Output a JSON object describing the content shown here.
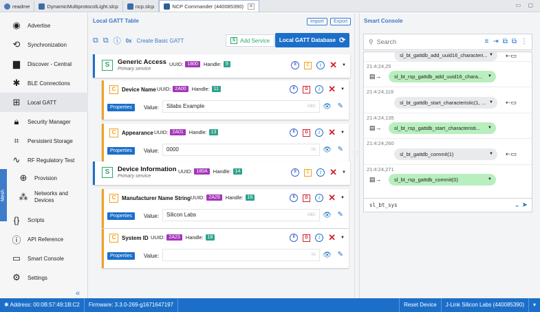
{
  "tabs": [
    {
      "label": "readme",
      "icon": "globe-icon"
    },
    {
      "label": "DynamicMultiprotocolLight.slcp",
      "icon": "project-icon"
    },
    {
      "label": "ncp.slcp",
      "icon": "project-icon"
    },
    {
      "label": "NCP Commander (440085390)",
      "icon": "ncp-icon"
    }
  ],
  "sidebar": {
    "items": [
      {
        "label": "Advertise",
        "icon": "broadcast-icon"
      },
      {
        "label": "Synchronization",
        "icon": "sync-icon"
      },
      {
        "label": "Discover - Central",
        "icon": "router-icon"
      },
      {
        "label": "BLE Connections",
        "icon": "bluetooth-icon"
      },
      {
        "label": "Local GATT",
        "icon": "table-icon"
      },
      {
        "label": "Security Manager",
        "icon": "lock-icon"
      },
      {
        "label": "Persistent Storage",
        "icon": "chip-icon"
      },
      {
        "label": "RF Regulatory Test",
        "icon": "wave-icon"
      },
      {
        "label": "Provision",
        "icon": "globe-icon"
      },
      {
        "label": "Networks and Devices",
        "icon": "network-icon"
      },
      {
        "label": "Scripts",
        "icon": "braces-icon"
      },
      {
        "label": "API Reference",
        "icon": "info-icon"
      },
      {
        "label": "Smart Console",
        "icon": "terminal-icon"
      },
      {
        "label": "Settings",
        "icon": "gear-icon"
      }
    ],
    "mesh_label": "Mesh",
    "collapse": "«"
  },
  "main": {
    "title": "Local GATT Table",
    "import": "Import",
    "export": "Export",
    "create_basic": "Create Basic GATT",
    "add_service": "Add Service",
    "local_db": "Local GATT Database",
    "services": [
      {
        "name": "Generic Access",
        "sub": "Primary service",
        "uuid": "1800",
        "handle": "9",
        "characteristics": [
          {
            "name": "Device Name",
            "uuid": "2A00",
            "handle": "11",
            "value": "Silabs Example",
            "format": "ABC"
          },
          {
            "name": "Appearance",
            "uuid": "2A01",
            "handle": "13",
            "value": "0000",
            "format": "0x"
          }
        ]
      },
      {
        "name": "Device Information",
        "sub": "Primary service",
        "uuid": "180A",
        "handle": "14",
        "characteristics": [
          {
            "name": "Manufacturer Name String",
            "uuid": "2A29",
            "handle": "16",
            "value": "Silicon Labs",
            "format": "ABC"
          },
          {
            "name": "System ID",
            "uuid": "2A23",
            "handle": "18",
            "value": "",
            "format": "0x"
          }
        ]
      }
    ],
    "labels": {
      "uuid": "UUID:",
      "handle": "Handle:",
      "properties": "Properties",
      "value": "Value:"
    }
  },
  "console": {
    "title": "Smart Console",
    "search_placeholder": "Search",
    "entries": [
      {
        "time": "",
        "text": "sl_bt_gattdb_add_uuid16_characteri...",
        "type": "cmd"
      },
      {
        "time": "21:4:24,25",
        "text": "sl_bt_rsp_gattdb_add_uuid16_chara...",
        "type": "rsp"
      },
      {
        "time": "21:4:24,119",
        "text": "sl_bt_gattdb_start_characteristic(1, ...",
        "type": "cmd"
      },
      {
        "time": "21:4:24,135",
        "text": "sl_bt_rsp_gattdb_start_characteristi...",
        "type": "rsp"
      },
      {
        "time": "21:4:24,260",
        "text": "sl_bt_gattdb_commit(1)",
        "type": "cmd"
      },
      {
        "time": "21:4:24,271",
        "text": "sl_bt_rsp_gattdb_commit(0)",
        "type": "rsp"
      }
    ],
    "command_value": "sl_bt_sys"
  },
  "status": {
    "address": "Address: 00:0B:57:49:1B:C2",
    "firmware": "Firmware: 3.3.0-269-g1671647197",
    "reset": "Reset Device",
    "jlink": "J-Link Silicon Labs (440085390)"
  },
  "colors": {
    "accent": "#1c6fc9",
    "service": "#2aa86a",
    "characteristic": "#f0a020",
    "uuid_pill": "#a436b9",
    "handle_pill": "#2ea38c",
    "response": "#b9eebf"
  }
}
